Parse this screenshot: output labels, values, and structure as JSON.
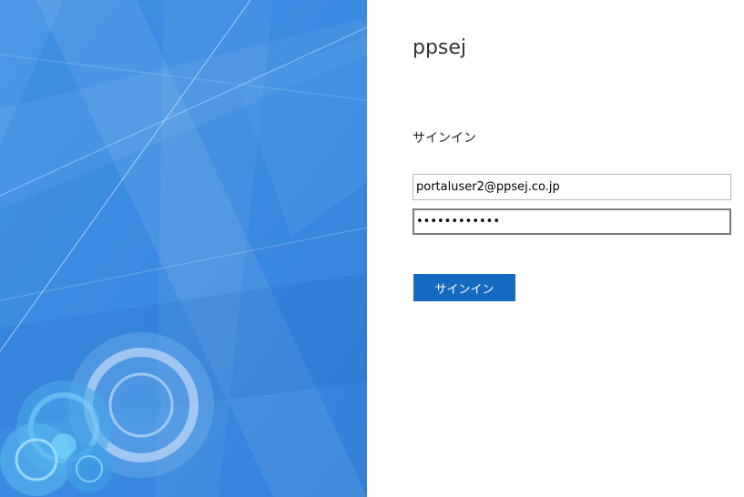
{
  "brand": {
    "org_name": "ppsej",
    "accent_color": "#1469c0",
    "illustration_color": "#3a8ae0"
  },
  "form": {
    "heading": "サインイン",
    "email_value": "portaluser2@ppsej.co.jp",
    "password_value": "••••••••••••",
    "submit_label": "サインイン"
  }
}
